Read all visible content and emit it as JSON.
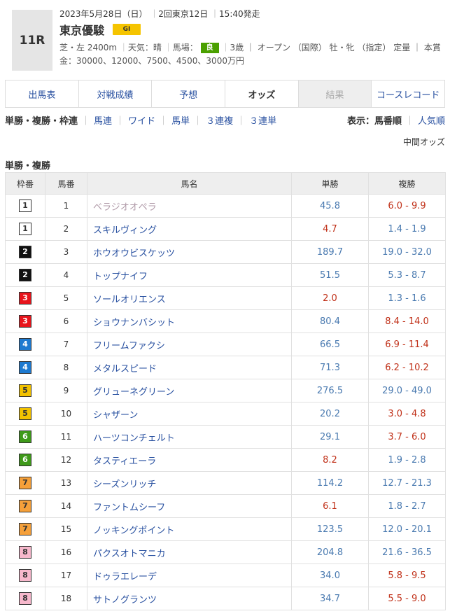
{
  "header": {
    "race_number": "11R",
    "date": "2023年5月28日（日）",
    "meeting": "2回東京12日",
    "start_time": "15:40発走",
    "title": "東京優駿",
    "grade": "GI",
    "course": "芝・左 2400m",
    "weather": "天気：晴",
    "ground_label": "馬場：",
    "ground_value": "良",
    "conditions": "3歳 ｜ オープン （国際） 牡・牝 （指定） 定量 ｜ 本賞",
    "prize": "金：30000、12000、7500、4500、3000万円"
  },
  "tabs": [
    {
      "label": "出馬表",
      "state": "normal"
    },
    {
      "label": "対戦成績",
      "state": "normal"
    },
    {
      "label": "予想",
      "state": "normal"
    },
    {
      "label": "オッズ",
      "state": "active"
    },
    {
      "label": "結果",
      "state": "disabled"
    },
    {
      "label": "コースレコード",
      "state": "normal"
    }
  ],
  "odds_nav": {
    "items": [
      "単勝・複勝・枠連",
      "馬連",
      "ワイド",
      "馬単",
      "３連複",
      "３連単"
    ],
    "display_label": "表示：",
    "sort_options": [
      "馬番順",
      "人気順"
    ]
  },
  "mid_odds_label": "中間オッズ",
  "section_title": "単勝・複勝",
  "table": {
    "headers": [
      "枠番",
      "馬番",
      "馬名",
      "単勝",
      "複勝"
    ],
    "rows": [
      {
        "waku": "1",
        "uma": "1",
        "name": "ベラジオオペラ",
        "win": "45.8",
        "place": "6.0 - 9.9",
        "faded": true,
        "win_hot": false,
        "place_hot": true
      },
      {
        "waku": "1",
        "uma": "2",
        "name": "スキルヴィング",
        "win": "4.7",
        "place": "1.4 - 1.9",
        "faded": false,
        "win_hot": true,
        "place_hot": false
      },
      {
        "waku": "2",
        "uma": "3",
        "name": "ホウオウビスケッツ",
        "win": "189.7",
        "place": "19.0 - 32.0",
        "faded": false,
        "win_hot": false,
        "place_hot": false
      },
      {
        "waku": "2",
        "uma": "4",
        "name": "トップナイフ",
        "win": "51.5",
        "place": "5.3 - 8.7",
        "faded": false,
        "win_hot": false,
        "place_hot": false
      },
      {
        "waku": "3",
        "uma": "5",
        "name": "ソールオリエンス",
        "win": "2.0",
        "place": "1.3 - 1.6",
        "faded": false,
        "win_hot": true,
        "place_hot": false
      },
      {
        "waku": "3",
        "uma": "6",
        "name": "ショウナンバシット",
        "win": "80.4",
        "place": "8.4 - 14.0",
        "faded": false,
        "win_hot": false,
        "place_hot": true
      },
      {
        "waku": "4",
        "uma": "7",
        "name": "フリームファクシ",
        "win": "66.5",
        "place": "6.9 - 11.4",
        "faded": false,
        "win_hot": false,
        "place_hot": true
      },
      {
        "waku": "4",
        "uma": "8",
        "name": "メタルスピード",
        "win": "71.3",
        "place": "6.2 - 10.2",
        "faded": false,
        "win_hot": false,
        "place_hot": true
      },
      {
        "waku": "5",
        "uma": "9",
        "name": "グリューネグリーン",
        "win": "276.5",
        "place": "29.0 - 49.0",
        "faded": false,
        "win_hot": false,
        "place_hot": false
      },
      {
        "waku": "5",
        "uma": "10",
        "name": "シャザーン",
        "win": "20.2",
        "place": "3.0 - 4.8",
        "faded": false,
        "win_hot": false,
        "place_hot": true
      },
      {
        "waku": "6",
        "uma": "11",
        "name": "ハーツコンチェルト",
        "win": "29.1",
        "place": "3.7 - 6.0",
        "faded": false,
        "win_hot": false,
        "place_hot": true
      },
      {
        "waku": "6",
        "uma": "12",
        "name": "タスティエーラ",
        "win": "8.2",
        "place": "1.9 - 2.8",
        "faded": false,
        "win_hot": true,
        "place_hot": false
      },
      {
        "waku": "7",
        "uma": "13",
        "name": "シーズンリッチ",
        "win": "114.2",
        "place": "12.7 - 21.3",
        "faded": false,
        "win_hot": false,
        "place_hot": false
      },
      {
        "waku": "7",
        "uma": "14",
        "name": "ファントムシーフ",
        "win": "6.1",
        "place": "1.8 - 2.7",
        "faded": false,
        "win_hot": true,
        "place_hot": false
      },
      {
        "waku": "7",
        "uma": "15",
        "name": "ノッキングポイント",
        "win": "123.5",
        "place": "12.0 - 20.1",
        "faded": false,
        "win_hot": false,
        "place_hot": false
      },
      {
        "waku": "8",
        "uma": "16",
        "name": "パクスオトマニカ",
        "win": "204.8",
        "place": "21.6 - 36.5",
        "faded": false,
        "win_hot": false,
        "place_hot": false
      },
      {
        "waku": "8",
        "uma": "17",
        "name": "ドゥラエレーデ",
        "win": "34.0",
        "place": "5.8 - 9.5",
        "faded": false,
        "win_hot": false,
        "place_hot": true
      },
      {
        "waku": "8",
        "uma": "18",
        "name": "サトノグランツ",
        "win": "34.7",
        "place": "5.5 - 9.0",
        "faded": false,
        "win_hot": false,
        "place_hot": true
      }
    ]
  },
  "waku_colors": {
    "1": {
      "bg": "#ffffff",
      "fg": "#333333"
    },
    "2": {
      "bg": "#111111",
      "fg": "#ffffff"
    },
    "3": {
      "bg": "#e8141c",
      "fg": "#ffffff"
    },
    "4": {
      "bg": "#1e7ad0",
      "fg": "#ffffff"
    },
    "5": {
      "bg": "#f2c200",
      "fg": "#333333"
    },
    "6": {
      "bg": "#3f9a1a",
      "fg": "#ffffff"
    },
    "7": {
      "bg": "#f5a03a",
      "fg": "#333333"
    },
    "8": {
      "bg": "#f7b8cc",
      "fg": "#333333"
    }
  }
}
